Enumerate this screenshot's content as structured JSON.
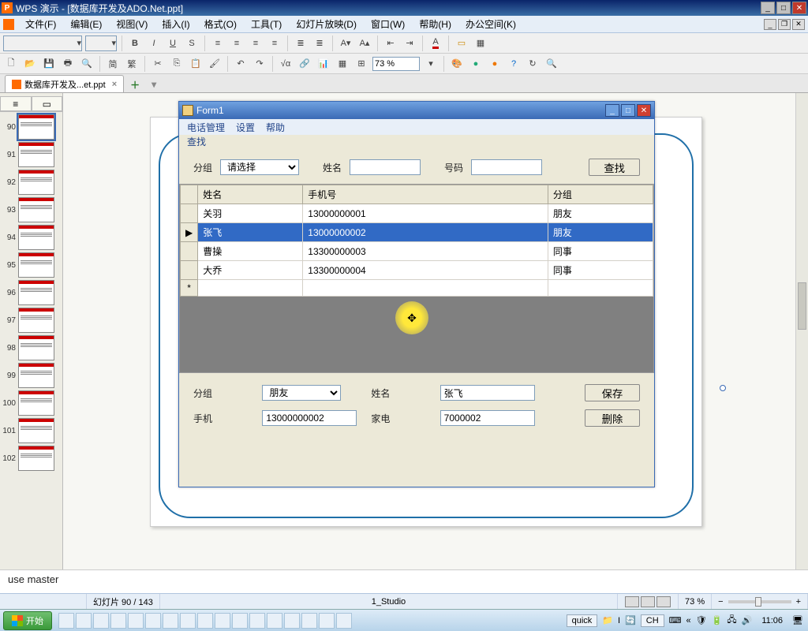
{
  "app": {
    "title": "WPS 演示 - [数据库开发及ADO.Net.ppt]",
    "tab_name": "数据库开发及...et.ppt"
  },
  "menu": {
    "file": "文件(F)",
    "edit": "编辑(E)",
    "view": "视图(V)",
    "insert": "插入(I)",
    "format": "格式(O)",
    "tools": "工具(T)",
    "slideshow": "幻灯片放映(D)",
    "window": "窗口(W)",
    "help": "帮助(H)",
    "office": "办公空间(K)"
  },
  "toolbar": {
    "zoom": "73 %"
  },
  "thumbs": {
    "selected": 90,
    "items": [
      90,
      91,
      92,
      93,
      94,
      95,
      96,
      97,
      98,
      99,
      100,
      101,
      102
    ]
  },
  "form1": {
    "title": "Form1",
    "menu": {
      "phone": "电话管理",
      "settings": "设置",
      "help": "帮助"
    },
    "sub": "查找",
    "search": {
      "group_label": "分组",
      "group_value": "请选择",
      "name_label": "姓名",
      "name_value": "",
      "number_label": "号码",
      "number_value": "",
      "find_btn": "查找"
    },
    "grid": {
      "cols": [
        "姓名",
        "手机号",
        "分组"
      ],
      "rows": [
        {
          "name": "关羽",
          "phone": "13000000001",
          "group": "朋友",
          "sel": false
        },
        {
          "name": "张飞",
          "phone": "13000000002",
          "group": "朋友",
          "sel": true
        },
        {
          "name": "曹操",
          "phone": "13300000003",
          "group": "同事",
          "sel": false
        },
        {
          "name": "大乔",
          "phone": "13300000004",
          "group": "同事",
          "sel": false
        }
      ],
      "row_marker_sel": "▶",
      "row_marker_new": "*"
    },
    "detail": {
      "group_label": "分组",
      "group_value": "朋友",
      "name_label": "姓名",
      "name_value": "张飞",
      "save_btn": "保存",
      "mobile_label": "手机",
      "mobile_value": "13000000002",
      "home_label": "家电",
      "home_value": "7000002",
      "delete_btn": "删除"
    }
  },
  "notes": {
    "line1": "use master"
  },
  "status": {
    "slide_counter": "幻灯片 90 / 143",
    "center": "1_Studio",
    "zoom": "73 %"
  },
  "taskbar": {
    "start": "开始",
    "quick": "quick",
    "ime": "CH",
    "clock": "11:06"
  }
}
